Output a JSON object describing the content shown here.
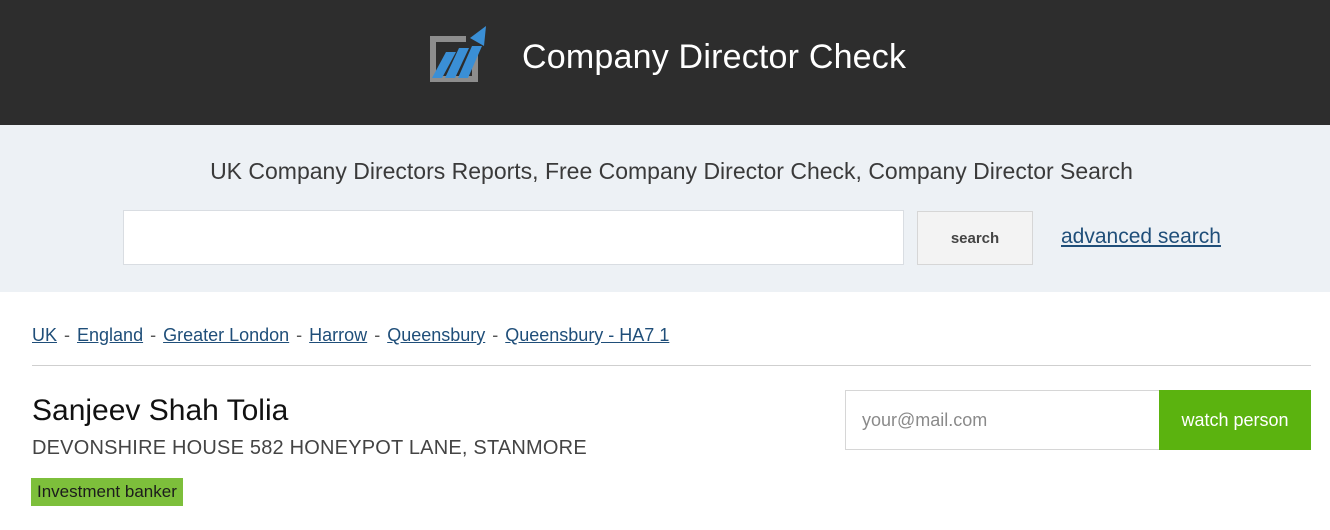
{
  "header": {
    "site_title": "Company Director Check",
    "logo_icon": "chart-arrow-logo-icon"
  },
  "search": {
    "tagline": "UK Company Directors Reports, Free Company Director Check, Company Director Search",
    "input_value": "",
    "input_placeholder": "",
    "button_label": "search",
    "advanced_link": "advanced search"
  },
  "breadcrumb": {
    "items": [
      "UK",
      "England",
      "Greater London",
      "Harrow",
      "Queensbury",
      "Queensbury - HA7 1"
    ],
    "separator": "-"
  },
  "person": {
    "name": "Sanjeev Shah Tolia",
    "address": "DEVONSHIRE HOUSE 582 HONEYPOT LANE, STANMORE",
    "occupation": "Investment banker"
  },
  "watch": {
    "email_placeholder": "your@mail.com",
    "button_label": "watch person"
  },
  "colors": {
    "header_bg": "#2d2d2d",
    "search_band_bg": "#edf1f5",
    "accent_green": "#5bb30f",
    "badge_green": "#7dbf3b",
    "link_blue": "#1f4e79",
    "logo_blue": "#3a8fd6",
    "logo_gray": "#8d8d8d"
  }
}
